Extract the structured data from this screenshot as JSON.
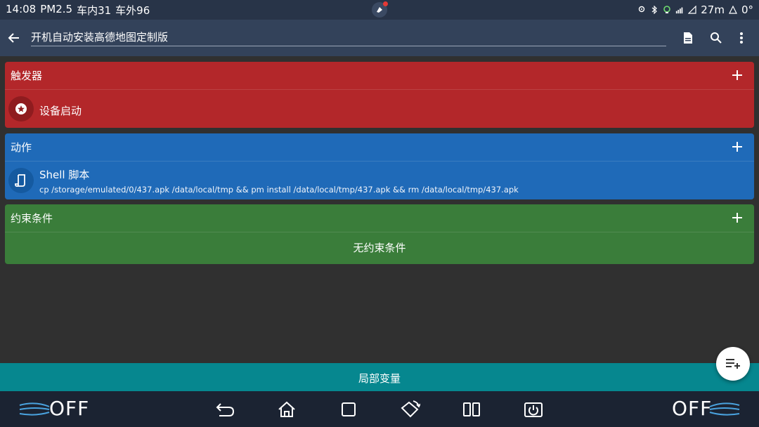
{
  "status_bar": {
    "time": "14:08",
    "pm25": "PM2.5",
    "inside": "车内31",
    "outside": "车外96",
    "signal_text": "27m",
    "temp": "0°"
  },
  "toolbar": {
    "title": "开机自动安装高德地图定制版"
  },
  "trigger_card": {
    "header": "触发器",
    "item_title": "设备启动"
  },
  "action_card": {
    "header": "动作",
    "item_title": "Shell 脚本",
    "item_sub": "cp /storage/emulated/0/437.apk /data/local/tmp && pm install /data/local/tmp/437.apk && rm /data/local/tmp/437.apk"
  },
  "constraint_card": {
    "header": "约束条件",
    "empty": "无约束条件"
  },
  "variables_bar": {
    "label": "局部变量"
  },
  "nav": {
    "left_off": "OFF",
    "right_off": "OFF"
  },
  "colors": {
    "trigger": "#b3272a",
    "action": "#1f6ab8",
    "constraint": "#3a7d3a",
    "variables": "#06878f"
  }
}
